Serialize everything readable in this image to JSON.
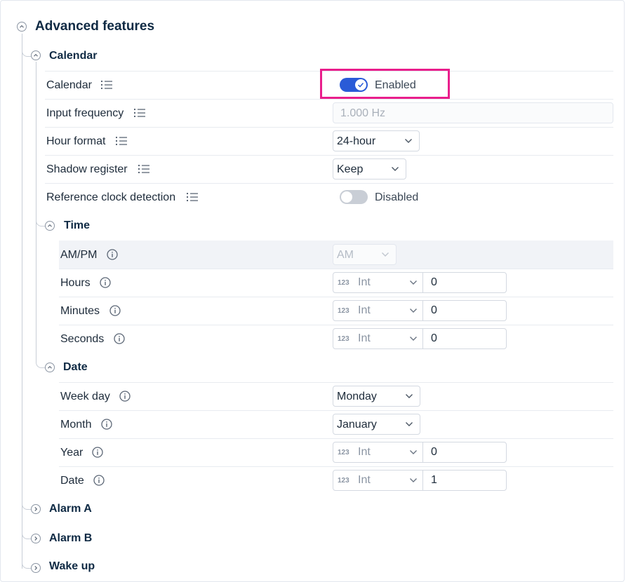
{
  "sections": {
    "advanced": "Advanced features",
    "calendar": "Calendar",
    "time": "Time",
    "date": "Date",
    "alarm_a": "Alarm A",
    "alarm_b": "Alarm B",
    "wake_up": "Wake up"
  },
  "calendar": {
    "calendar_label": "Calendar",
    "calendar_toggle": {
      "state": "on",
      "label": "Enabled"
    },
    "input_frequency_label": "Input frequency",
    "input_frequency_value": "1.000 Hz",
    "hour_format_label": "Hour format",
    "hour_format_value": "24-hour",
    "shadow_register_label": "Shadow register",
    "shadow_register_value": "Keep",
    "ref_clock_label": "Reference clock detection",
    "ref_clock_toggle": {
      "state": "off",
      "label": "Disabled"
    }
  },
  "time": {
    "ampm_label": "AM/PM",
    "ampm_value": "AM",
    "hours_label": "Hours",
    "minutes_label": "Minutes",
    "seconds_label": "Seconds",
    "type_badge": "123",
    "type_label": "Int",
    "hours_value": "0",
    "minutes_value": "0",
    "seconds_value": "0"
  },
  "date": {
    "weekday_label": "Week day",
    "weekday_value": "Monday",
    "month_label": "Month",
    "month_value": "January",
    "year_label": "Year",
    "year_value": "0",
    "date_label": "Date",
    "date_value": "1",
    "type_badge": "123",
    "type_label": "Int"
  },
  "colors": {
    "accent": "#2a5bd7",
    "highlight": "#e91e8c",
    "toggle_off": "#c9ced6"
  },
  "icons": [
    "collapse-icon",
    "expand-icon",
    "list-icon",
    "info-icon",
    "chevron-down-icon",
    "check-icon"
  ]
}
